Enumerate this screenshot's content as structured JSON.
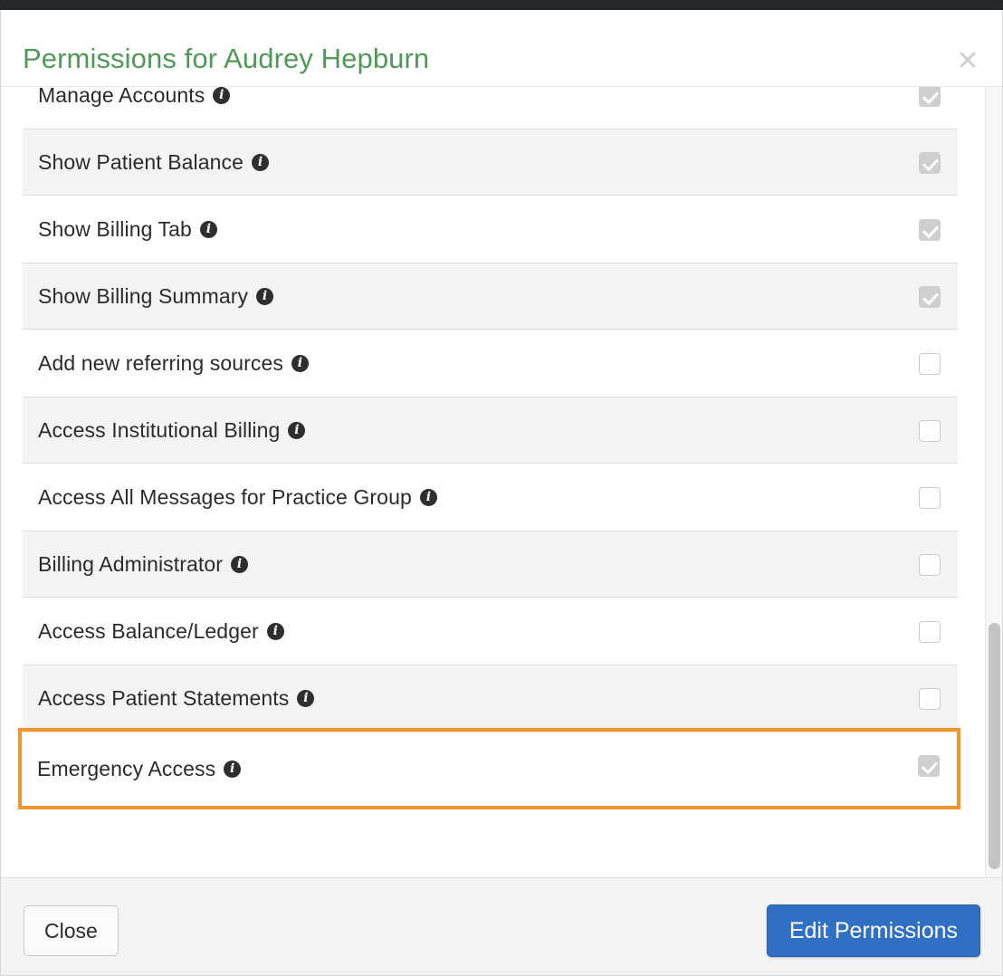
{
  "topbar": {
    "present": true,
    "color": "#26292c"
  },
  "modal": {
    "title": "Permissions for Audrey Hepburn",
    "title_color": "#4e9a56",
    "close_icon": "close-icon",
    "close_glyph": "✕",
    "highlight_color": "#f0962c",
    "permissions": [
      {
        "label": "Manage Accounts",
        "info": "i",
        "checked": true,
        "striped": false,
        "clipped": true,
        "highlighted": false
      },
      {
        "label": "Show Patient Balance",
        "info": "i",
        "checked": true,
        "striped": true,
        "clipped": false,
        "highlighted": false
      },
      {
        "label": "Show Billing Tab",
        "info": "i",
        "checked": true,
        "striped": false,
        "clipped": false,
        "highlighted": false
      },
      {
        "label": "Show Billing Summary",
        "info": "i",
        "checked": true,
        "striped": true,
        "clipped": false,
        "highlighted": false
      },
      {
        "label": "Add new referring sources",
        "info": "i",
        "checked": false,
        "striped": false,
        "clipped": false,
        "highlighted": false
      },
      {
        "label": "Access Institutional Billing",
        "info": "i",
        "checked": false,
        "striped": true,
        "clipped": false,
        "highlighted": false
      },
      {
        "label": "Access All Messages for Practice Group",
        "info": "i",
        "checked": false,
        "striped": false,
        "clipped": false,
        "highlighted": false
      },
      {
        "label": "Billing Administrator",
        "info": "i",
        "checked": false,
        "striped": true,
        "clipped": false,
        "highlighted": false
      },
      {
        "label": "Access Balance/Ledger",
        "info": "i",
        "checked": false,
        "striped": false,
        "clipped": false,
        "highlighted": false
      },
      {
        "label": "Access Patient Statements",
        "info": "i",
        "checked": false,
        "striped": true,
        "clipped": false,
        "highlighted": false
      },
      {
        "label": "Emergency Access",
        "info": "i",
        "checked": true,
        "striped": false,
        "clipped": false,
        "highlighted": true
      }
    ],
    "scrollbar": {
      "name": "vertical-scrollbar",
      "thumb_top_pct": 67,
      "thumb_height_pct": 31
    },
    "footer": {
      "close_label": "Close",
      "edit_label": "Edit Permissions",
      "edit_color": "#2f6fc4"
    }
  }
}
